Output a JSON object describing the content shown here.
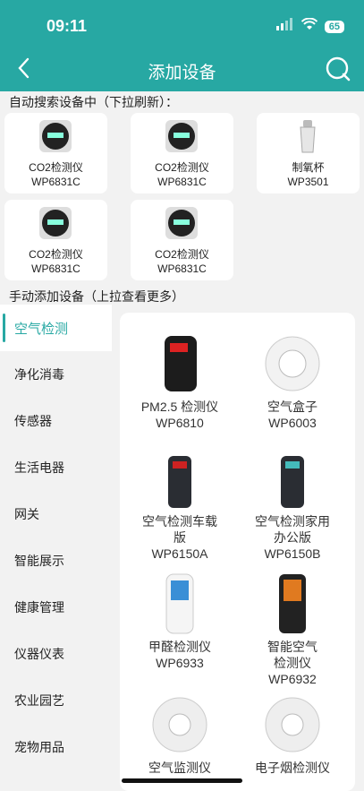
{
  "status": {
    "time": "09:11",
    "battery": "65"
  },
  "nav": {
    "title": "添加设备"
  },
  "auto_section": {
    "label": "自动搜索设备中（下拉刷新）："
  },
  "auto_devices": [
    {
      "name": "CO2检测仪",
      "model": "WP6831C"
    },
    {
      "name": "CO2检测仪",
      "model": "WP6831C"
    },
    {
      "name": "制氧杯",
      "model": "WP3501"
    },
    {
      "name": "CO2检测仪",
      "model": "WP6831C"
    },
    {
      "name": "CO2检测仪",
      "model": "WP6831C"
    }
  ],
  "manual_section": {
    "label": "手动添加设备（上拉查看更多）"
  },
  "categories": [
    "空气检测",
    "净化消毒",
    "传感器",
    "生活电器",
    "网关",
    "智能展示",
    "健康管理",
    "仪器仪表",
    "农业园艺",
    "宠物用品"
  ],
  "products": [
    {
      "name": "PM2.5 检测仪",
      "model": "WP6810"
    },
    {
      "name": "空气盒子",
      "model": "WP6003"
    },
    {
      "name": "空气检测车载\n版",
      "model": "WP6150A"
    },
    {
      "name": "空气检测家用\n办公版",
      "model": "WP6150B"
    },
    {
      "name": "甲醛检测仪",
      "model": "WP6933"
    },
    {
      "name": "智能空气\n检测仪",
      "model": "WP6932"
    },
    {
      "name": "空气监测仪",
      "model": ""
    },
    {
      "name": "电子烟检测仪",
      "model": ""
    }
  ],
  "colors": {
    "accent": "#27a8a3",
    "background": "#f2f2f2"
  }
}
